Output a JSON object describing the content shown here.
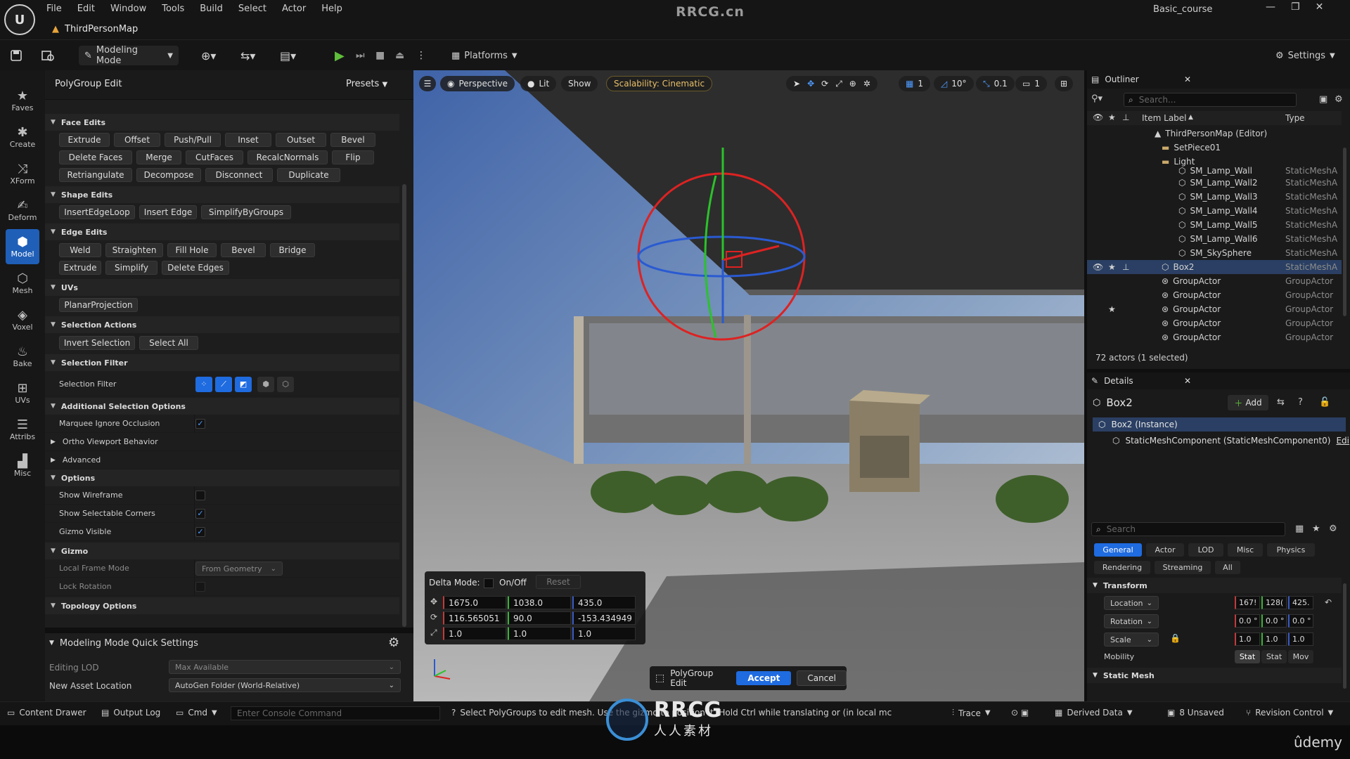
{
  "window": {
    "menu": [
      "File",
      "Edit",
      "Window",
      "Tools",
      "Build",
      "Select",
      "Actor",
      "Help"
    ],
    "map_tab": "ThirdPersonMap",
    "site_title": "RRCG.cn",
    "project": "Basic_course",
    "logo_text": "U"
  },
  "toolbar": {
    "mode": "Modeling Mode",
    "platforms": "Platforms",
    "settings": "Settings"
  },
  "palette": [
    {
      "label": "Faves",
      "icon": "star-icon"
    },
    {
      "label": "Create",
      "icon": "create-icon"
    },
    {
      "label": "XForm",
      "icon": "xform-icon"
    },
    {
      "label": "Deform",
      "icon": "deform-icon"
    },
    {
      "label": "Model",
      "icon": "model-icon",
      "active": true
    },
    {
      "label": "Mesh",
      "icon": "mesh-icon"
    },
    {
      "label": "Voxel",
      "icon": "voxel-icon"
    },
    {
      "label": "Bake",
      "icon": "bake-icon"
    },
    {
      "label": "UVs",
      "icon": "uvs-icon"
    },
    {
      "label": "Attribs",
      "icon": "attribs-icon"
    },
    {
      "label": "Misc",
      "icon": "misc-icon"
    }
  ],
  "polygroup": {
    "title": "PolyGroup Edit",
    "presets": "Presets",
    "face_edits": {
      "header": "Face Edits",
      "row1": [
        "Extrude",
        "Offset",
        "Push/Pull",
        "Inset",
        "Outset",
        "Bevel"
      ],
      "row2": [
        "Delete Faces",
        "Merge",
        "CutFaces",
        "RecalcNormals",
        "Flip"
      ],
      "row3": [
        "Retriangulate",
        "Decompose",
        "Disconnect",
        "Duplicate"
      ]
    },
    "shape_edits": {
      "header": "Shape Edits",
      "row1": [
        "InsertEdgeLoop",
        "Insert Edge",
        "SimplifyByGroups"
      ]
    },
    "edge_edits": {
      "header": "Edge Edits",
      "row1": [
        "Weld",
        "Straighten",
        "Fill Hole",
        "Bevel",
        "Bridge"
      ],
      "row2": [
        "Extrude",
        "Simplify",
        "Delete Edges"
      ]
    },
    "uvs": {
      "header": "UVs",
      "row1": [
        "PlanarProjection"
      ]
    },
    "selection_actions": {
      "header": "Selection Actions",
      "row1": [
        "Invert Selection",
        "Select All"
      ]
    },
    "selection_filter": {
      "header": "Selection Filter",
      "label": "Selection Filter"
    },
    "additional": {
      "header": "Additional Selection Options",
      "marquee": "Marquee Ignore Occlusion",
      "ortho": "Ortho Viewport Behavior",
      "advanced": "Advanced"
    },
    "options": {
      "header": "Options",
      "wireframe": "Show Wireframe",
      "corners": "Show Selectable Corners",
      "gizmo_visible": "Gizmo Visible"
    },
    "gizmo": {
      "header": "Gizmo",
      "frame_mode": "Local Frame Mode",
      "frame_value": "From Geometry",
      "lock_rotation": "Lock Rotation"
    },
    "topology": "Topology Options"
  },
  "quick_settings": {
    "header": "Modeling Mode Quick Settings",
    "lod_label": "Editing LOD",
    "lod_value": "Max Available",
    "asset_label": "New Asset Location",
    "asset_value": "AutoGen Folder (World-Relative)"
  },
  "viewport": {
    "perspective": "Perspective",
    "lit": "Lit",
    "show": "Show",
    "scalability": "Scalability: Cinematic",
    "grid": "1",
    "angle": "10°",
    "scale": "0.1",
    "cam": "1",
    "delta": {
      "mode_label": "Delta Mode:",
      "onoff": "On/Off",
      "reset": "Reset",
      "loc": [
        "1675.0",
        "1038.0",
        "435.0"
      ],
      "rot": [
        "116.565051",
        "90.0",
        "-153.434949"
      ],
      "scale": [
        "1.0",
        "1.0",
        "1.0"
      ]
    },
    "accept": {
      "tool": "PolyGroup Edit",
      "accept": "Accept",
      "cancel": "Cancel"
    }
  },
  "outliner": {
    "title": "Outliner",
    "search": "Search...",
    "col_label": "Item Label",
    "col_type": "Type",
    "rows": [
      {
        "label": "ThirdPersonMap (Editor)",
        "type": ""
      },
      {
        "label": "SetPiece01",
        "type": ""
      },
      {
        "label": "Light",
        "type": ""
      },
      {
        "label": "SM_Lamp_Wall",
        "type": "StaticMeshA"
      },
      {
        "label": "SM_Lamp_Wall2",
        "type": "StaticMeshA"
      },
      {
        "label": "SM_Lamp_Wall3",
        "type": "StaticMeshA"
      },
      {
        "label": "SM_Lamp_Wall4",
        "type": "StaticMeshA"
      },
      {
        "label": "SM_Lamp_Wall5",
        "type": "StaticMeshA"
      },
      {
        "label": "SM_Lamp_Wall6",
        "type": "StaticMeshA"
      },
      {
        "label": "SM_SkySphere",
        "type": "StaticMeshA"
      },
      {
        "label": "Box2",
        "type": "StaticMeshA"
      },
      {
        "label": "GroupActor",
        "type": "GroupActor"
      },
      {
        "label": "GroupActor",
        "type": "GroupActor"
      },
      {
        "label": "GroupActor",
        "type": "GroupActor"
      },
      {
        "label": "GroupActor",
        "type": "GroupActor"
      },
      {
        "label": "GroupActor",
        "type": "GroupActor"
      }
    ],
    "count": "72 actors (1 selected)"
  },
  "details": {
    "title": "Details",
    "actor": "Box2",
    "add": "Add",
    "instance": "Box2 (Instance)",
    "component": "StaticMeshComponent (StaticMeshComponent0)",
    "component_edit": "Edi",
    "search": "Search",
    "tabs1": [
      "General",
      "Actor",
      "LOD",
      "Misc",
      "Physics"
    ],
    "tabs2": [
      "Rendering",
      "Streaming",
      "All"
    ],
    "transform": "Transform",
    "location": "Location",
    "rotation": "Rotation",
    "scale": "Scale",
    "loc_vals": [
      "167!",
      "128(",
      "425."
    ],
    "rot_vals": [
      "0.0 °",
      "0.0 °",
      "0.0 °"
    ],
    "scale_vals": [
      "1.0",
      "1.0",
      "1.0"
    ],
    "mobility": "Mobility",
    "mob_opts": [
      "Stat",
      "Stat",
      "Mov"
    ],
    "static_mesh": "Static Mesh"
  },
  "statusbar": {
    "content_drawer": "Content Drawer",
    "output_log": "Output Log",
    "cmd": "Cmd",
    "console_placeholder": "Enter Console Command",
    "hint": "Select PolyGroups to edit mesh. Use the gizmo to position it. Hold Ctrl while translating or (in local mc",
    "trace": "Trace",
    "derived": "Derived Data",
    "unsaved": "8 Unsaved",
    "revision": "Revision Control"
  },
  "watermark": {
    "brand": "RRCG",
    "sub": "人人素材",
    "udemy": "ûdemy"
  },
  "colors": {
    "accent": "#1f6be0",
    "active_mode": "#1f5fb8",
    "warn": "#e8a43a"
  }
}
